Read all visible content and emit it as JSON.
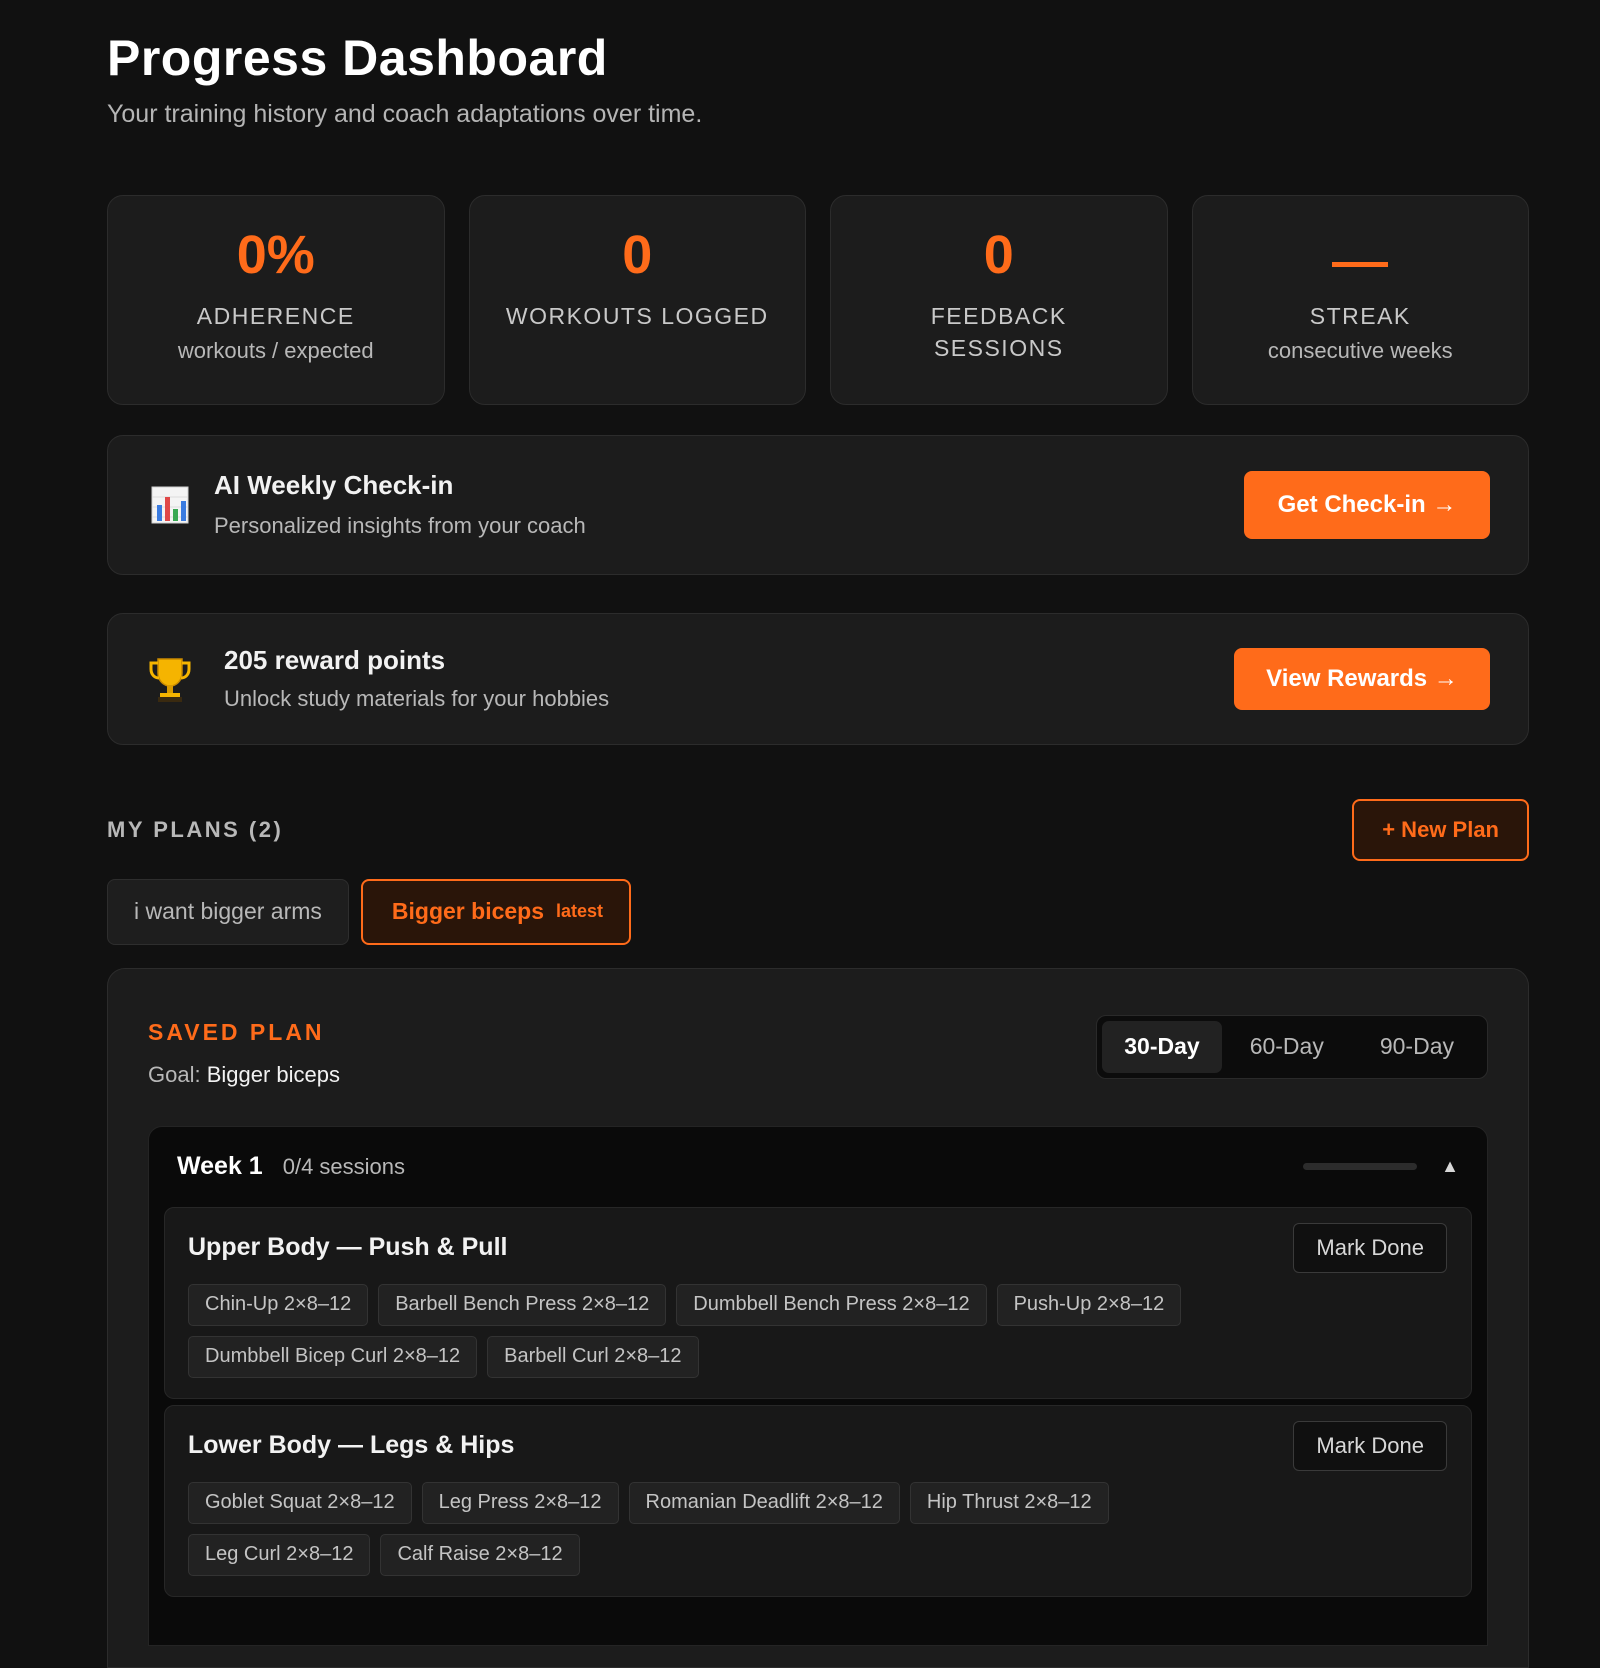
{
  "header": {
    "title": "Progress Dashboard",
    "subtitle": "Your training history and coach adaptations over time."
  },
  "stats": [
    {
      "value": "0%",
      "label": "ADHERENCE",
      "sub": "workouts / expected"
    },
    {
      "value": "0",
      "label": "WORKOUTS LOGGED",
      "sub": ""
    },
    {
      "value": "0",
      "label": "FEEDBACK SESSIONS",
      "sub": ""
    },
    {
      "value": "—",
      "label": "STREAK",
      "sub": "consecutive weeks"
    }
  ],
  "checkin": {
    "icon": "bar-chart-icon",
    "title": "AI Weekly Check-in",
    "description": "Personalized insights from your coach",
    "button_label": "Get Check-in →"
  },
  "rewards": {
    "icon": "trophy-icon",
    "title": "205 reward points",
    "description": "Unlock study materials for your hobbies",
    "button_label": "View Rewards →"
  },
  "plans": {
    "title": "MY PLANS (2)",
    "new_plan_label": "+ New Plan",
    "tabs": [
      {
        "label": "i want bigger arms",
        "badge": ""
      },
      {
        "label": "Bigger biceps",
        "badge": "latest"
      }
    ]
  },
  "saved_plan": {
    "label": "SAVED PLAN",
    "goal_label": "Goal:",
    "goal_value": "Bigger biceps",
    "durations": [
      "30-Day",
      "60-Day",
      "90-Day"
    ],
    "selected_duration": "30-Day"
  },
  "week": {
    "title": "Week 1",
    "sessions": "0/4 sessions",
    "progress": 0,
    "toggle": "▲"
  },
  "sessions": [
    {
      "title": "Upper Body — Push & Pull",
      "button_label": "Mark Done",
      "exercises": [
        "Chin-Up 2×8–12",
        "Barbell Bench Press 2×8–12",
        "Dumbbell Bench Press 2×8–12",
        "Push-Up 2×8–12",
        "Dumbbell Bicep Curl 2×8–12",
        "Barbell Curl 2×8–12"
      ]
    },
    {
      "title": "Lower Body — Legs & Hips",
      "button_label": "Mark Done",
      "exercises": [
        "Goblet Squat 2×8–12",
        "Leg Press 2×8–12",
        "Romanian Deadlift 2×8–12",
        "Hip Thrust 2×8–12",
        "Leg Curl 2×8–12",
        "Calf Raise 2×8–12"
      ]
    }
  ],
  "colors": {
    "accent": "#ff6b1a",
    "background": "#111111",
    "card": "#1c1c1c"
  }
}
